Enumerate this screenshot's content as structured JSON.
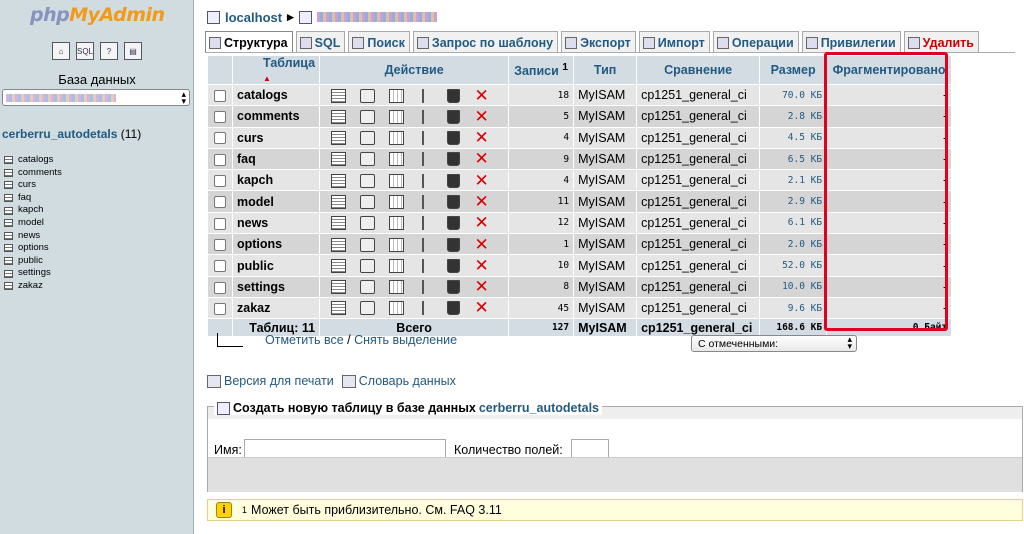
{
  "sidebar": {
    "logo_php": "php",
    "logo_myadmin": "MyAdmin",
    "quick_icons": [
      "home-icon",
      "sql-icon",
      "help-icon",
      "docs-icon"
    ],
    "db_label": "База данных",
    "db_name": "cerberru_autodetals",
    "db_count": "(11)",
    "tables": [
      "catalogs",
      "comments",
      "curs",
      "faq",
      "kapch",
      "model",
      "news",
      "options",
      "public",
      "settings",
      "zakaz"
    ]
  },
  "breadcrumb": {
    "server": "localhost"
  },
  "tabs": [
    {
      "label": "Структура",
      "icon": "structure-icon"
    },
    {
      "label": "SQL",
      "icon": "sql-icon"
    },
    {
      "label": "Поиск",
      "icon": "search-icon"
    },
    {
      "label": "Запрос по шаблону",
      "icon": "query-icon"
    },
    {
      "label": "Экспорт",
      "icon": "export-icon"
    },
    {
      "label": "Импорт",
      "icon": "import-icon"
    },
    {
      "label": "Операции",
      "icon": "operations-icon"
    },
    {
      "label": "Привилегии",
      "icon": "privileges-icon"
    },
    {
      "label": "Удалить",
      "icon": "drop-icon"
    }
  ],
  "table": {
    "headers": {
      "table": "Таблица",
      "action": "Действие",
      "records": "Записи",
      "records_note": "1",
      "type": "Тип",
      "collation": "Сравнение",
      "size": "Размер",
      "overhead": "Фрагментировано"
    },
    "rows": [
      {
        "name": "catalogs",
        "records": "18",
        "type": "MyISAM",
        "collation": "cp1251_general_ci",
        "size": "70.0 КБ",
        "overhead": "-"
      },
      {
        "name": "comments",
        "records": "5",
        "type": "MyISAM",
        "collation": "cp1251_general_ci",
        "size": "2.8 КБ",
        "overhead": "-"
      },
      {
        "name": "curs",
        "records": "4",
        "type": "MyISAM",
        "collation": "cp1251_general_ci",
        "size": "4.5 КБ",
        "overhead": "-"
      },
      {
        "name": "faq",
        "records": "9",
        "type": "MyISAM",
        "collation": "cp1251_general_ci",
        "size": "6.5 КБ",
        "overhead": "-"
      },
      {
        "name": "kapch",
        "records": "4",
        "type": "MyISAM",
        "collation": "cp1251_general_ci",
        "size": "2.1 КБ",
        "overhead": "-"
      },
      {
        "name": "model",
        "records": "11",
        "type": "MyISAM",
        "collation": "cp1251_general_ci",
        "size": "2.9 КБ",
        "overhead": "-"
      },
      {
        "name": "news",
        "records": "12",
        "type": "MyISAM",
        "collation": "cp1251_general_ci",
        "size": "6.1 КБ",
        "overhead": "-"
      },
      {
        "name": "options",
        "records": "1",
        "type": "MyISAM",
        "collation": "cp1251_general_ci",
        "size": "2.0 КБ",
        "overhead": "-"
      },
      {
        "name": "public",
        "records": "10",
        "type": "MyISAM",
        "collation": "cp1251_general_ci",
        "size": "52.0 КБ",
        "overhead": "-"
      },
      {
        "name": "settings",
        "records": "8",
        "type": "MyISAM",
        "collation": "cp1251_general_ci",
        "size": "10.0 КБ",
        "overhead": "-"
      },
      {
        "name": "zakaz",
        "records": "45",
        "type": "MyISAM",
        "collation": "cp1251_general_ci",
        "size": "9.6 КБ",
        "overhead": "-"
      }
    ],
    "footer": {
      "tables_label": "Таблиц: 11",
      "total_label": "Всего",
      "records": "127",
      "type": "MyISAM",
      "collation": "cp1251_general_ci",
      "size": "168.6 КБ",
      "overhead": "0 Байт"
    }
  },
  "selection": {
    "check_all": "Отметить все",
    "separator": " / ",
    "uncheck_all": "Снять выделение",
    "with_selected": "С отмеченными:"
  },
  "links": {
    "print_view": "Версия для печати",
    "data_dictionary": "Словарь данных"
  },
  "create_table": {
    "legend": "Создать новую таблицу в базе данных",
    "db": "cerberru_autodetals",
    "name_label": "Имя:",
    "fields_label": "Количество полей:",
    "name_value": "",
    "fields_value": ""
  },
  "footnote": {
    "mark": "1",
    "text": "Может быть приблизительно. См. FAQ 3.11"
  },
  "colors": {
    "link": "#235a81",
    "highlight_box": "#e00020",
    "sidebar_bg": "#d0dce0"
  }
}
